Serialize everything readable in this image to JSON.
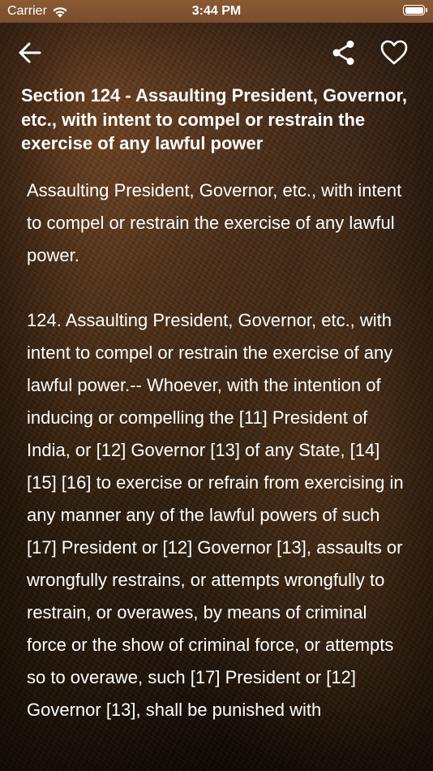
{
  "status_bar": {
    "carrier": "Carrier",
    "time": "3:44 PM",
    "icons": [
      "wifi-icon",
      "battery-icon"
    ]
  },
  "nav": {
    "icons": [
      "back-arrow-icon",
      "share-icon",
      "heart-icon"
    ]
  },
  "section": {
    "title": "Section 124 - Assaulting President, Governor, etc., with intent to compel or restrain the exercise of any lawful power",
    "summary": "Assaulting President, Governor, etc., with intent to compel or restrain the exercise of any lawful power.",
    "text": "124. Assaulting President, Governor, etc., with intent to compel or restrain the exercise of any lawful power.-- Whoever, with the intention of inducing or compelling the [11] President of India, or [12] Governor [13] of any State, [14] [15] [16] to exercise or refrain from exercising in any manner any of the lawful powers of such [17] President or [12] Governor [13], assaults or wrongfully restrains, or attempts wrongfully to restrain, or overawes, by means of criminal force or the show of criminal force, or attempts so to overawe, such [17] President or [12] Governor [13], shall be punished with"
  },
  "colors": {
    "status_bar": "#7a4d2c",
    "background": "#3b2616",
    "text": "#ffffff"
  }
}
